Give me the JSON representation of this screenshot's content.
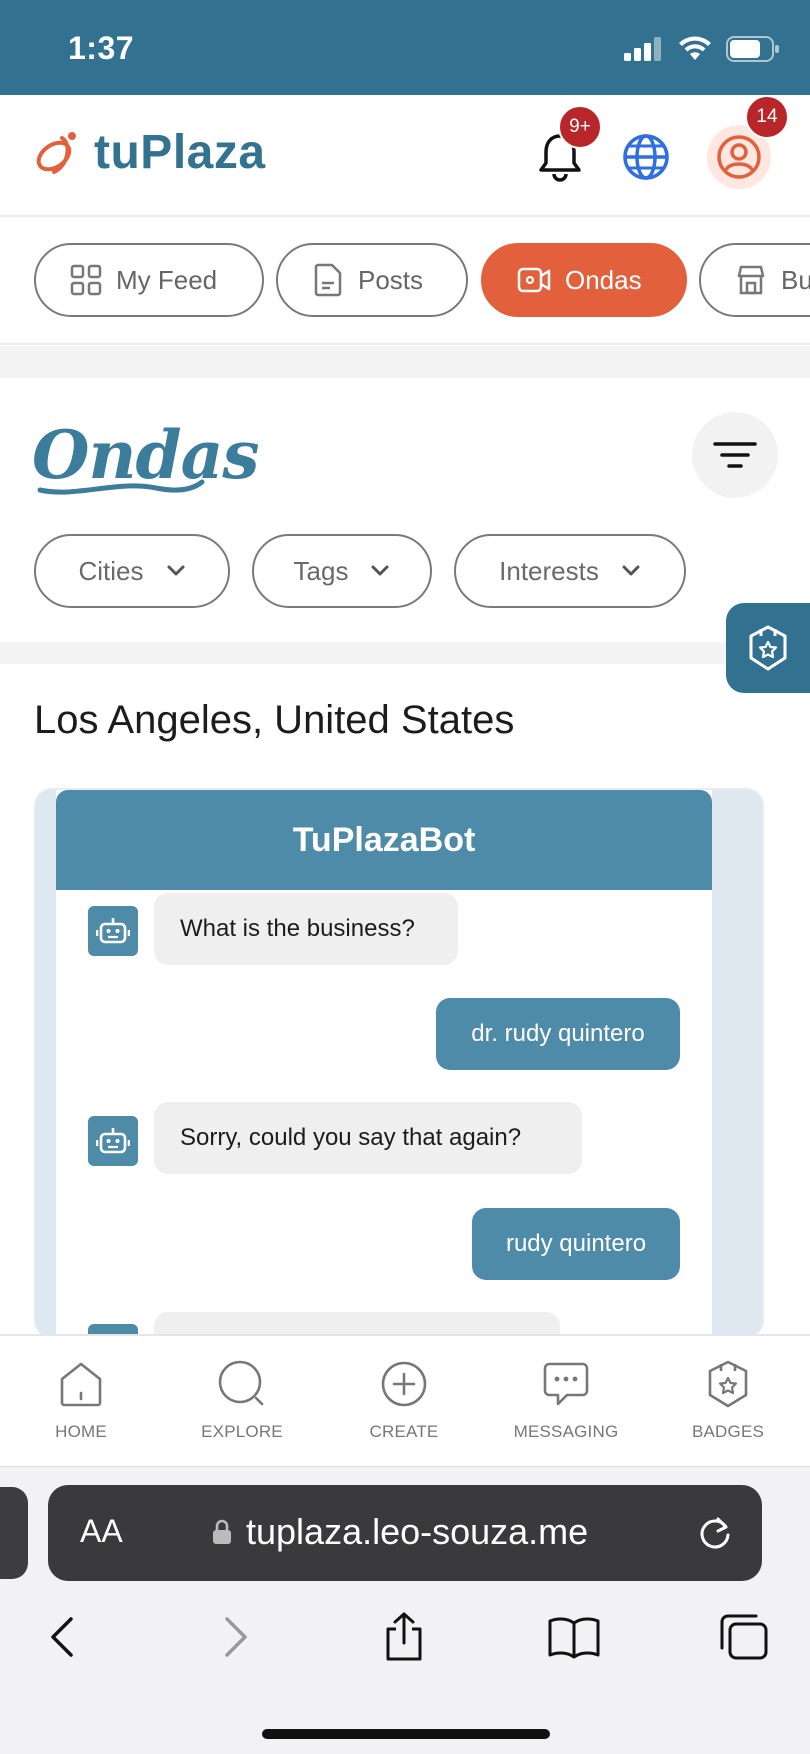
{
  "status_bar": {
    "time": "1:37",
    "battery_level": 0.75
  },
  "header": {
    "app_name": "tuPlaza",
    "notifications_badge": "9+",
    "profile_badge": "14",
    "colors": {
      "brand": "#33738f",
      "accent": "#e2613c"
    }
  },
  "tabs": [
    {
      "label": "My Feed",
      "icon": "grid-icon"
    },
    {
      "label": "Posts",
      "icon": "document-icon"
    },
    {
      "label": "Ondas",
      "icon": "video-icon",
      "active": true
    },
    {
      "label": "Bu",
      "icon": "store-icon"
    }
  ],
  "ondas": {
    "title": "Ondas",
    "filters": [
      {
        "label": "Cities"
      },
      {
        "label": "Tags"
      },
      {
        "label": "Interests"
      }
    ]
  },
  "location": "Los Angeles, United States",
  "chat": {
    "title": "TuPlazaBot",
    "messages": [
      {
        "from": "bot",
        "text": "What is the business?"
      },
      {
        "from": "user",
        "text": "dr. rudy quintero"
      },
      {
        "from": "bot",
        "text": "Sorry, could you say that again?"
      },
      {
        "from": "user",
        "text": "rudy quintero"
      },
      {
        "from": "bot",
        "text": ""
      }
    ]
  },
  "bottom_nav": [
    {
      "label": "HOME",
      "icon": "home-icon"
    },
    {
      "label": "EXPLORE",
      "icon": "search-icon"
    },
    {
      "label": "CREATE",
      "icon": "plus-circle-icon"
    },
    {
      "label": "MESSAGING",
      "icon": "chat-icon"
    },
    {
      "label": "BADGES",
      "icon": "badge-icon"
    }
  ],
  "browser": {
    "text_size_label": "AA",
    "url": "tuplaza.leo-souza.me"
  }
}
